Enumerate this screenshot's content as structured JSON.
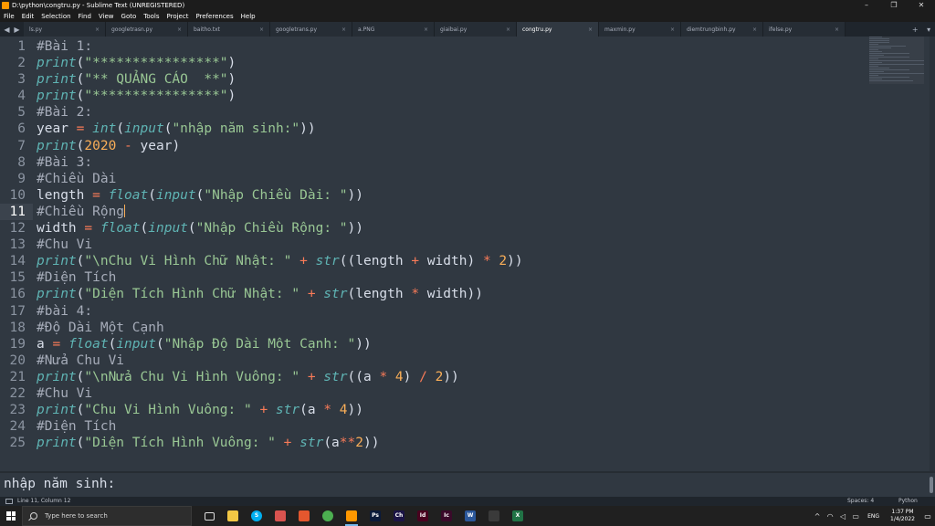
{
  "window": {
    "title": "D:\\python\\congtru.py - Sublime Text (UNREGISTERED)",
    "controls": {
      "minimize": "–",
      "maximize": "❐",
      "close": "✕"
    }
  },
  "menu": [
    "File",
    "Edit",
    "Selection",
    "Find",
    "View",
    "Goto",
    "Tools",
    "Project",
    "Preferences",
    "Help"
  ],
  "tabs": {
    "nav_left": "◀",
    "nav_right": "▶",
    "items": [
      "ls.py",
      "googletrasn.py",
      "baitho.txt",
      "googletrans.py",
      "a.PNG",
      "giaibai.py",
      "congtru.py",
      "maxmin.py",
      "diemtrungbinh.py",
      "ifelse.py"
    ],
    "active_index": 6,
    "close_glyph": "×",
    "add_glyph": "+",
    "more_glyph": "▾"
  },
  "editor": {
    "current_line": 11,
    "lines": [
      "1",
      "2",
      "3",
      "4",
      "5",
      "6",
      "7",
      "8",
      "9",
      "10",
      "11",
      "12",
      "13",
      "14",
      "15",
      "16",
      "17",
      "18",
      "19",
      "20",
      "21",
      "22",
      "23",
      "24",
      "25"
    ],
    "code": {
      "l1": "#Bài 1:",
      "l2_fn": "print",
      "l2_str": "\"****************\"",
      "l3_fn": "print",
      "l3_str": "\"** QUẢNG CÁO  **\"",
      "l4_fn": "print",
      "l4_str": "\"****************\"",
      "l5": "#Bài 2:",
      "l6_var": "year ",
      "l6_op": "=",
      "l6_fn1": "int",
      "l6_fn2": "input",
      "l6_str": "\"nhập năm sinh:\"",
      "l7_fn": "print",
      "l7_num": "2020",
      "l7_op": "-",
      "l7_var": "year",
      "l8": "#Bài 3:",
      "l9": "#Chiều Dài",
      "l10_var": "length ",
      "l10_op": "=",
      "l10_fn1": "float",
      "l10_fn2": "input",
      "l10_str": "\"Nhập Chiều Dài: \"",
      "l11": "#Chiều Rộng",
      "l12_var": "width ",
      "l12_op": "=",
      "l12_fn1": "float",
      "l12_fn2": "input",
      "l12_str": "\"Nhập Chiều Rộng: \"",
      "l13": "#Chu Vi",
      "l14_fn": "print",
      "l14_str": "\"\\nChu Vi Hình Chữ Nhật: \"",
      "l14_op1": "+",
      "l14_fn2": "str",
      "l14_v1": "length ",
      "l14_op2": "+",
      "l14_v2": " width",
      "l14_op3": "*",
      "l14_num": "2",
      "l15": "#Diện Tích",
      "l16_fn": "print",
      "l16_str": "\"Diện Tích Hình Chữ Nhật: \"",
      "l16_op1": "+",
      "l16_fn2": "str",
      "l16_v1": "length ",
      "l16_op2": "*",
      "l16_v2": " width",
      "l17": "#bài 4:",
      "l18": "#Độ Dài Một Cạnh",
      "l19_var": "a ",
      "l19_op": "=",
      "l19_fn1": "float",
      "l19_fn2": "input",
      "l19_str": "\"Nhập Độ Dài Một Cạnh: \"",
      "l20": "#Nửa Chu Vi",
      "l21_fn": "print",
      "l21_str": "\"\\nNửa Chu Vi Hình Vuông: \"",
      "l21_op1": "+",
      "l21_fn2": "str",
      "l21_v1": "a ",
      "l21_op2": "*",
      "l21_n1": "4",
      "l21_op3": "/",
      "l21_n2": "2",
      "l22": "#Chu Vi",
      "l23_fn": "print",
      "l23_str": "\"Chu Vi Hình Vuông: \"",
      "l23_op1": "+",
      "l23_fn2": "str",
      "l23_v1": "a ",
      "l23_op2": "*",
      "l23_n1": "4",
      "l24": "#Diện Tích",
      "l25_fn": "print",
      "l25_str": "\"Diện Tích Hình Vuông: \"",
      "l25_op1": "+",
      "l25_fn2": "str",
      "l25_v1": "a",
      "l25_op2": "**",
      "l25_n1": "2"
    }
  },
  "console": {
    "text": "nhập năm sinh:"
  },
  "status": {
    "position": "Line 11, Column 12",
    "spaces": "Spaces: 4",
    "syntax": "Python"
  },
  "taskbar": {
    "search_placeholder": "Type here to search",
    "apps": [
      {
        "name": "task-view",
        "label": "",
        "color": "#202020"
      },
      {
        "name": "file-explorer",
        "label": "",
        "color": "#f2c744"
      },
      {
        "name": "skype",
        "label": "S",
        "color": "#00aff0"
      },
      {
        "name": "snipping-tool",
        "label": "",
        "color": "#d9534f"
      },
      {
        "name": "paint",
        "label": "",
        "color": "#e4572e"
      },
      {
        "name": "chrome",
        "label": "",
        "color": "#4caf50"
      },
      {
        "name": "sublime-text",
        "label": "",
        "color": "#ff9800"
      },
      {
        "name": "photoshop",
        "label": "Ps",
        "color": "#0a1a3a"
      },
      {
        "name": "character-animator",
        "label": "Ch",
        "color": "#1b1446"
      },
      {
        "name": "indesign",
        "label": "Id",
        "color": "#49021f"
      },
      {
        "name": "incopy",
        "label": "Ic",
        "color": "#3a0a2a"
      },
      {
        "name": "word",
        "label": "W",
        "color": "#2b579a"
      },
      {
        "name": "terminal",
        "label": "",
        "color": "#3a3a3a"
      },
      {
        "name": "excel",
        "label": "X",
        "color": "#217346"
      }
    ],
    "active_app": "sublime-text",
    "tray": {
      "chevron": "^",
      "lang": "ENG",
      "time": "1:37 PM",
      "date": "1/4/2022",
      "notifications": "▭"
    }
  }
}
